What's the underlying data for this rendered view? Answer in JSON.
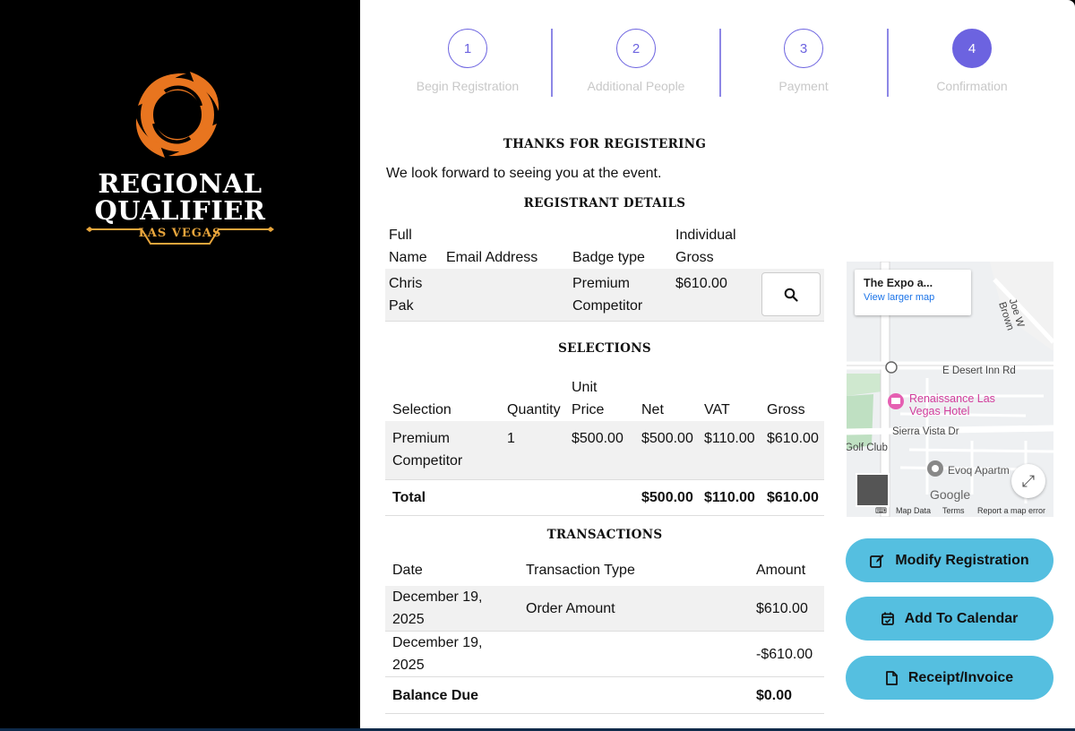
{
  "brand": {
    "line1": "REGIONAL",
    "line2": "QUALIFIER",
    "line3": "LAS VEGAS",
    "swirl_color": "#e8751f",
    "accent_color": "#e8a53c"
  },
  "steps": [
    {
      "number": "1",
      "label": "Begin Registration",
      "active": false
    },
    {
      "number": "2",
      "label": "Additional People",
      "active": false
    },
    {
      "number": "3",
      "label": "Payment",
      "active": false
    },
    {
      "number": "4",
      "label": "Confirmation",
      "active": true
    }
  ],
  "thanks": {
    "heading": "THANKS FOR REGISTERING",
    "message": "We look forward to seeing you at the event."
  },
  "registrant": {
    "heading": "REGISTRANT DETAILS",
    "columns": [
      "Full Name",
      "Email Address",
      "Badge type",
      "Individual Gross"
    ],
    "rows": [
      {
        "full_name": "Chris Pak",
        "email": "",
        "badge": "Premium Competitor",
        "gross": "$610.00"
      }
    ]
  },
  "selections": {
    "heading": "SELECTIONS",
    "columns": [
      "Selection",
      "Quantity",
      "Unit Price",
      "Net",
      "VAT",
      "Gross"
    ],
    "rows": [
      {
        "selection": "Premium Competitor",
        "quantity": "1",
        "unit_price": "$500.00",
        "net": "$500.00",
        "vat": "$110.00",
        "gross": "$610.00"
      }
    ],
    "total": {
      "label": "Total",
      "net": "$500.00",
      "vat": "$110.00",
      "gross": "$610.00"
    }
  },
  "transactions": {
    "heading": "TRANSACTIONS",
    "columns": [
      "Date",
      "Transaction Type",
      "Amount"
    ],
    "rows": [
      {
        "date": "December 19, 2025",
        "type": "Order Amount",
        "amount": "$610.00"
      },
      {
        "date": "December 19, 2025",
        "type": "",
        "amount": "-$610.00"
      }
    ],
    "balance": {
      "label": "Balance Due",
      "amount": "$0.00"
    }
  },
  "map": {
    "place_title": "The Expo a...",
    "view_larger": "View larger map",
    "street_desert_inn": "E Desert Inn Rd",
    "street_joe_brown": "Joe W Brown",
    "street_sierra_vista": "Sierra Vista Dr",
    "poi_hotel": "Renaissance Las Vegas Hotel",
    "poi_evoq": "Evoq Apartm",
    "golf": "Golf Club",
    "google": "Google",
    "footer_map_data": "Map Data",
    "footer_terms": "Terms",
    "footer_report": "Report a map error"
  },
  "actions": {
    "modify": "Modify Registration",
    "calendar": "Add To Calendar",
    "receipt": "Receipt/Invoice",
    "button_color": "#55bfe0"
  },
  "accent": "#6c63e0"
}
